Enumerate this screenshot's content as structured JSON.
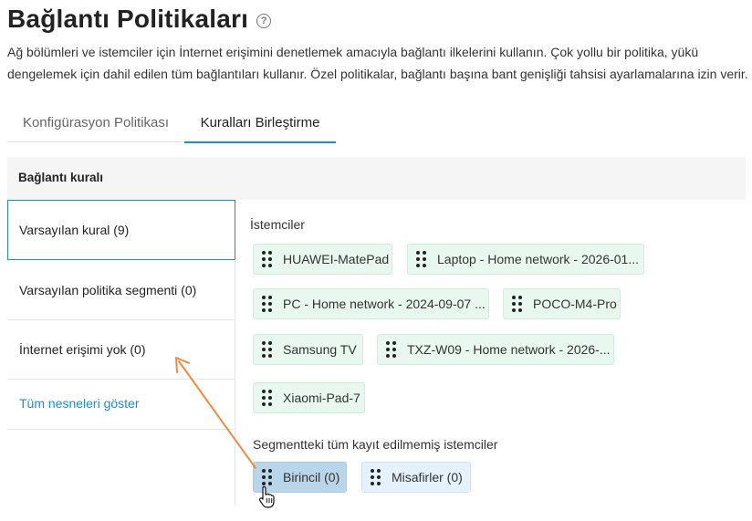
{
  "header": {
    "title": "Bağlantı Politikaları",
    "help_icon": "?"
  },
  "description": "Ağ bölümleri ve istemciler için İnternet erişimini denetlemek amacıyla bağlantı ilkelerini kullanın. Çok yollu bir politika, yükü dengelemek için dahil edilen tüm bağlantıları kullanır. Özel politikalar, bağlantı başına bant genişliği tahsisi ayarlamalarına izin verir.",
  "tabs": [
    {
      "label": "Konfigürasyon Politikası",
      "active": false
    },
    {
      "label": "Kuralları Birleştirme",
      "active": true
    }
  ],
  "panel": {
    "header": "Bağlantı kuralı",
    "rules": [
      {
        "label": "Varsayılan kural (9)",
        "active": true
      },
      {
        "label": "Varsayılan politika segmenti (0)",
        "active": false
      },
      {
        "label": "İnternet erişimi yok (0)",
        "active": false
      }
    ],
    "show_all_link": "Tüm nesneleri göster",
    "clients_label": "İstemciler",
    "clients": [
      "HUAWEI-MatePad",
      "Laptop - Home network - 2026-01...",
      "PC - Home network - 2024-09-07 ...",
      "POCO-M4-Pro",
      "Samsung TV",
      "TXZ-W09 - Home network - 2026-...",
      "Xiaomi-Pad-7"
    ],
    "segments_label": "Segmentteki tüm kayıt edilmemiş istemciler",
    "segments": [
      {
        "label": "Birincil (0)",
        "selected": true
      },
      {
        "label": "Misafirler (0)",
        "selected": false
      }
    ]
  },
  "colors": {
    "accent": "#1a8fd0",
    "client_chip_bg": "#e8f8ee",
    "segment_chip_bg": "#e5f2fb",
    "selected_chip_bg": "#b9d5ea",
    "annotation_arrow": "#f08a3c"
  },
  "icons": {
    "help": "help-circle-icon",
    "drag": "drag-handle-icon",
    "cursor": "hand-pointer-icon",
    "annotation": "orange-arrow-icon"
  }
}
